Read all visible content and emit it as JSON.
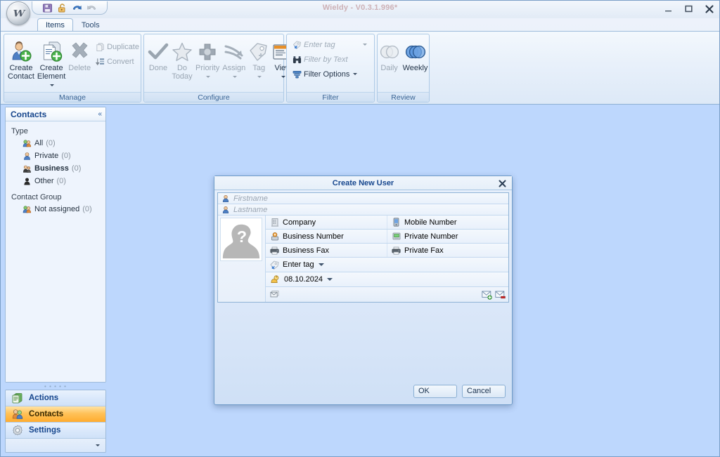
{
  "window": {
    "title": "Wieldy - V0.3.1.996*",
    "minimize_label": "–",
    "maximize_label": "▭",
    "close_label": "✕",
    "orb_glyph": "W",
    "quick_access": [
      {
        "name": "save-icon",
        "label": "Save"
      },
      {
        "name": "lock-icon",
        "label": "Lock"
      },
      {
        "name": "undo-icon",
        "label": "Undo"
      },
      {
        "name": "redo-icon",
        "label": "Redo"
      }
    ]
  },
  "ribbon": {
    "tabs": [
      {
        "label": "Items",
        "active": true
      },
      {
        "label": "Tools",
        "active": false
      }
    ],
    "groups": [
      {
        "title": "Manage",
        "big_buttons": [
          {
            "label_line1": "Create",
            "label_line2": "Contact",
            "icon": "create-contact-icon",
            "disabled": false,
            "has_caret": false
          },
          {
            "label_line1": "Create",
            "label_line2": "Element",
            "icon": "create-element-icon",
            "disabled": false,
            "has_caret": true
          },
          {
            "label_line1": "Delete",
            "label_line2": "",
            "icon": "delete-icon",
            "disabled": true,
            "has_caret": false
          }
        ],
        "small_buttons": [
          {
            "label": "Duplicate",
            "icon": "duplicate-icon",
            "disabled": true
          },
          {
            "label": "Convert",
            "icon": "convert-icon",
            "disabled": true
          }
        ]
      },
      {
        "title": "Configure",
        "big_buttons": [
          {
            "label_line1": "Done",
            "label_line2": "",
            "icon": "done-check-icon",
            "disabled": true,
            "has_caret": false
          },
          {
            "label_line1": "Do",
            "label_line2": "Today",
            "icon": "do-today-star-icon",
            "disabled": true,
            "has_caret": false
          },
          {
            "label_line1": "Priority",
            "label_line2": "",
            "icon": "priority-icon",
            "disabled": true,
            "has_caret": true
          },
          {
            "label_line1": "Assign",
            "label_line2": "",
            "icon": "assign-arrow-icon",
            "disabled": true,
            "has_caret": true
          },
          {
            "label_line1": "Tag",
            "label_line2": "",
            "icon": "tag-icon",
            "disabled": true,
            "has_caret": true
          },
          {
            "label_line1": "View",
            "label_line2": "",
            "icon": "view-window-icon",
            "disabled": false,
            "has_caret": true
          }
        ],
        "small_buttons": []
      },
      {
        "title": "Filter",
        "big_buttons": [],
        "small_buttons": [
          {
            "label": "Enter tag",
            "icon": "tag-filter-icon",
            "disabled": true,
            "ghost": true,
            "has_caret": true
          },
          {
            "label": "Filter by Text",
            "icon": "binoculars-icon",
            "disabled": true,
            "ghost": true,
            "has_caret": false
          },
          {
            "label": "Filter Options",
            "icon": "filter-options-icon",
            "disabled": false,
            "ghost": false,
            "has_caret": true
          }
        ]
      },
      {
        "title": "Review",
        "big_buttons": [
          {
            "label_line1": "Daily",
            "label_line2": "",
            "icon": "daily-circles-icon",
            "disabled": true,
            "has_caret": false
          },
          {
            "label_line1": "Weekly",
            "label_line2": "",
            "icon": "weekly-circles-icon",
            "disabled": false,
            "has_caret": false
          }
        ],
        "small_buttons": []
      }
    ]
  },
  "navpane": {
    "header_title": "Contacts",
    "collapse_label": "«",
    "sections": [
      {
        "label": "Type",
        "items": [
          {
            "label": "All",
            "count": "(0)",
            "icon": "contacts-all-icon",
            "bold": false
          },
          {
            "label": "Private",
            "count": "(0)",
            "icon": "contact-private-icon",
            "bold": false
          },
          {
            "label": "Business",
            "count": "(0)",
            "icon": "contact-business-icon",
            "bold": true
          },
          {
            "label": "Other",
            "count": "(0)",
            "icon": "contact-other-icon",
            "bold": false
          }
        ]
      },
      {
        "label": "Contact Group",
        "items": [
          {
            "label": "Not assigned",
            "count": "(0)",
            "icon": "contact-group-icon",
            "bold": false
          }
        ]
      }
    ],
    "buttons": [
      {
        "label": "Actions",
        "icon": "actions-icon",
        "selected": false
      },
      {
        "label": "Contacts",
        "icon": "contacts-icon",
        "selected": true
      },
      {
        "label": "Settings",
        "icon": "settings-gear-icon",
        "selected": false
      }
    ]
  },
  "dialog": {
    "title": "Create New User",
    "close_label": "✕",
    "avatar_alt": "unknown-user-placeholder",
    "fields": {
      "firstname": {
        "placeholder": "Firstname",
        "value": "",
        "icon": "person-icon"
      },
      "lastname": {
        "placeholder": "Lastname",
        "value": "",
        "icon": "person-icon"
      },
      "company": {
        "placeholder": "Company",
        "value": "",
        "icon": "company-building-icon"
      },
      "mobile_number": {
        "placeholder": "Mobile Number",
        "value": "",
        "icon": "mobile-phone-icon"
      },
      "business_number": {
        "placeholder": "Business Number",
        "value": "",
        "icon": "business-phone-icon"
      },
      "private_number": {
        "placeholder": "Private Number",
        "value": "",
        "icon": "private-phone-icon"
      },
      "business_fax": {
        "placeholder": "Business Fax",
        "value": "",
        "icon": "fax-icon"
      },
      "private_fax": {
        "placeholder": "Private Fax",
        "value": "",
        "icon": "fax-icon"
      },
      "tag": {
        "placeholder": "Enter tag",
        "value": "",
        "icon": "tag-icon"
      },
      "birthday": {
        "placeholder": "",
        "value": "08.10.2024",
        "icon": "birthday-icon"
      },
      "email": {
        "placeholder": "",
        "value": "",
        "icon": "mail-icon"
      }
    },
    "mail_actions": [
      {
        "name": "add-email-icon",
        "label": "Add email"
      },
      {
        "name": "remove-email-icon",
        "label": "Remove email"
      }
    ],
    "buttons": {
      "ok_label": "OK",
      "cancel_label": "Cancel"
    }
  },
  "colors": {
    "workspace_bg": "#bdd7fd",
    "accent_selected": "#ffbe51",
    "nav_title": "#15458c",
    "title_text": "#cdb1b6"
  }
}
